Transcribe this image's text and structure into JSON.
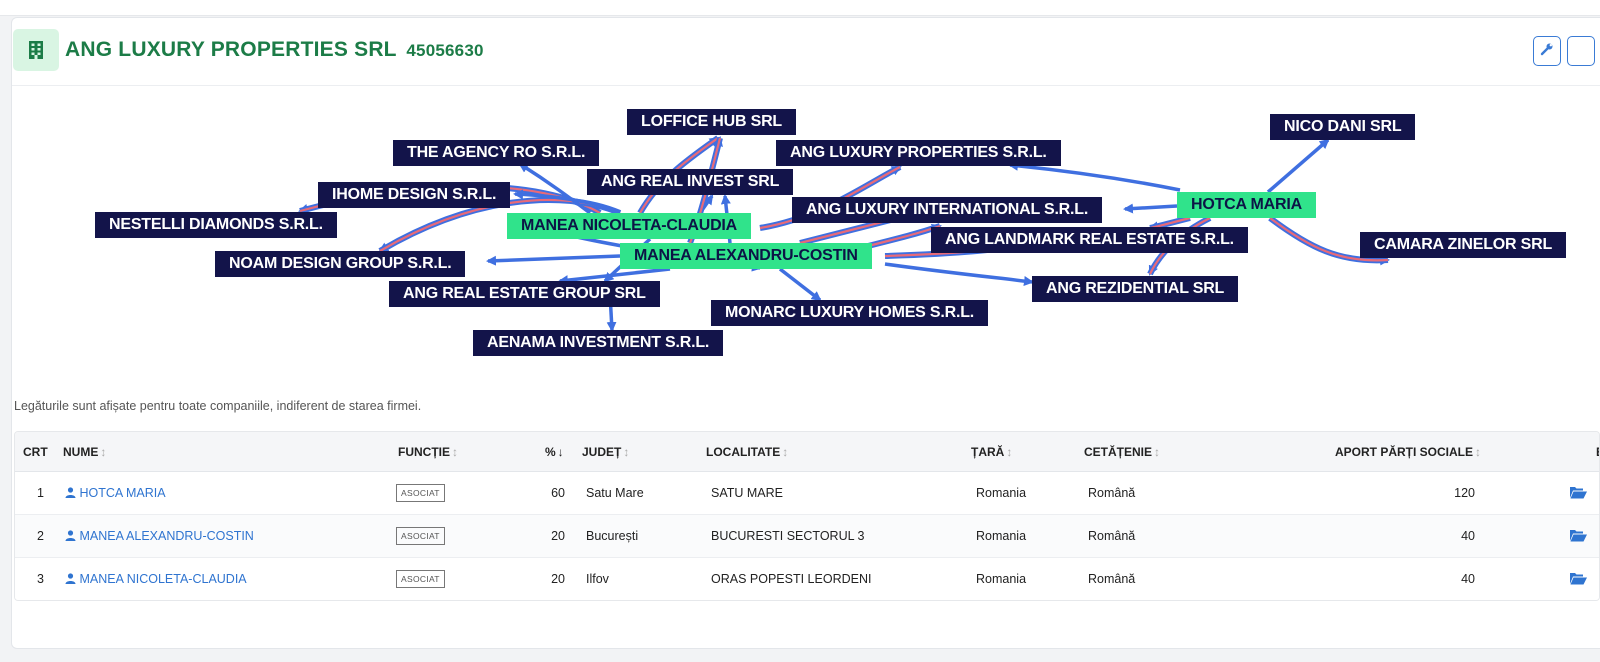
{
  "company": {
    "name": "ANG LUXURY PROPERTIES SRL",
    "code": "45056630",
    "icon": "building-icon",
    "accent_color": "#1c7c47"
  },
  "header_buttons": [
    {
      "icon": "wrench-icon"
    }
  ],
  "graph": {
    "nodes": [
      {
        "id": "loffice",
        "label": "LOFFICE HUB SRL",
        "kind": "company"
      },
      {
        "id": "agencyro",
        "label": "THE AGENCY RO S.R.L.",
        "kind": "company"
      },
      {
        "id": "angluxprop",
        "label": "ANG LUXURY PROPERTIES S.R.L.",
        "kind": "company"
      },
      {
        "id": "nicodani",
        "label": "NICO DANI SRL",
        "kind": "company"
      },
      {
        "id": "angrealinvest",
        "label": "ANG REAL INVEST SRL",
        "kind": "company"
      },
      {
        "id": "ihome",
        "label": "IHOME DESIGN S.R.L.",
        "kind": "company"
      },
      {
        "id": "nestelli",
        "label": "NESTELLI DIAMONDS S.R.L.",
        "kind": "company"
      },
      {
        "id": "maneanicoleta",
        "label": "MANEA NICOLETA-CLAUDIA",
        "kind": "person"
      },
      {
        "id": "angluxint",
        "label": "ANG LUXURY INTERNATIONAL S.R.L.",
        "kind": "company"
      },
      {
        "id": "hotca",
        "label": "HOTCA MARIA",
        "kind": "person"
      },
      {
        "id": "anglandmark",
        "label": "ANG LANDMARK REAL ESTATE S.R.L.",
        "kind": "company"
      },
      {
        "id": "camara",
        "label": "CAMARA ZINELOR SRL",
        "kind": "company"
      },
      {
        "id": "noam",
        "label": "NOAM DESIGN GROUP S.R.L.",
        "kind": "company"
      },
      {
        "id": "maneaalex",
        "label": "MANEA ALEXANDRU-COSTIN",
        "kind": "person"
      },
      {
        "id": "angrealestate",
        "label": "ANG REAL ESTATE GROUP SRL",
        "kind": "company"
      },
      {
        "id": "angrez",
        "label": "ANG REZIDENTIAL SRL",
        "kind": "company"
      },
      {
        "id": "monarc",
        "label": "MONARC LUXURY HOMES S.R.L.",
        "kind": "company"
      },
      {
        "id": "aenama",
        "label": "AENAMA INVESTMENT S.R.L.",
        "kind": "company"
      }
    ],
    "colors": {
      "company_bg": "#13144a",
      "person_bg": "#30e38b",
      "edge_blue": "#3f6fe0",
      "edge_red": "#e86a78"
    }
  },
  "note": "Legăturile sunt afișate pentru toate companiile, indiferent de starea firmei.",
  "table": {
    "columns": [
      "CRT",
      "NUME",
      "FUNCȚIE",
      "%",
      "JUDEȚ",
      "LOCALITATE",
      "ȚARĂ",
      "CETĂȚENIE",
      "APORT PĂRȚI SOCIALE",
      "E"
    ],
    "sort_icons": {
      "default": "↕",
      "active": "↓"
    },
    "rows": [
      {
        "crt": "1",
        "nume": "HOTCA MARIA",
        "functie": "ASOCIAT",
        "procent": "60",
        "judet": "Satu Mare",
        "localitate": "SATU MARE",
        "tara": "Romania",
        "cetatenie": "Română",
        "aport": "120"
      },
      {
        "crt": "2",
        "nume": "MANEA ALEXANDRU-COSTIN",
        "functie": "ASOCIAT",
        "procent": "20",
        "judet": "București",
        "localitate": "BUCURESTI SECTORUL 3",
        "tara": "Romania",
        "cetatenie": "Română",
        "aport": "40"
      },
      {
        "crt": "3",
        "nume": "MANEA NICOLETA-CLAUDIA",
        "functie": "ASOCIAT",
        "procent": "20",
        "judet": "Ilfov",
        "localitate": "ORAS POPESTI LEORDENI",
        "tara": "Romania",
        "cetatenie": "Română",
        "aport": "40"
      }
    ]
  }
}
